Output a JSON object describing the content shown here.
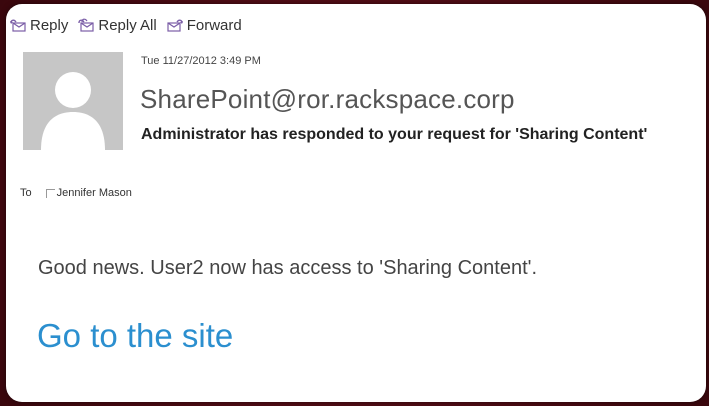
{
  "toolbar": {
    "reply_label": "Reply",
    "reply_all_label": "Reply All",
    "forward_label": "Forward"
  },
  "message": {
    "date": "Tue 11/27/2012 3:49 PM",
    "sender": "SharePoint@ror.rackspace.corp",
    "subject": "Administrator has responded to your request for 'Sharing Content'",
    "to_label": "To",
    "recipient": "Jennifer Mason",
    "body_text": "Good news. User2 now has access to 'Sharing Content'.",
    "link_text": "Go to the site"
  },
  "icons": {
    "reply": "reply-icon",
    "reply_all": "reply-all-icon",
    "forward": "forward-icon",
    "avatar": "person-placeholder"
  },
  "colors": {
    "link": "#2b8fcf",
    "background_frame": "#5a0f17",
    "avatar_bg": "#c6c6c6",
    "icon_purple": "#7b5ea7"
  }
}
